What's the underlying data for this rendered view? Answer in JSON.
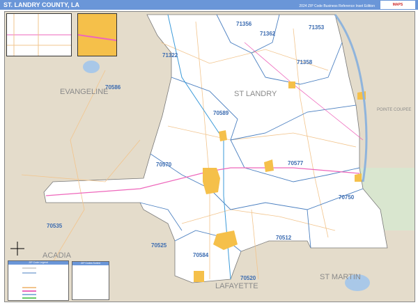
{
  "header": {
    "title": "ST. LANDRY COUNTY, LA",
    "edition": "2024 ZIP Code Business Reference Inset Edition",
    "logo": "MAPS"
  },
  "map": {
    "zip_labels": [
      {
        "code": "71322"
      },
      {
        "code": "71356"
      },
      {
        "code": "71362"
      },
      {
        "code": "71353"
      },
      {
        "code": "71358"
      },
      {
        "code": "70586"
      },
      {
        "code": "70589"
      },
      {
        "code": "70570"
      },
      {
        "code": "70577"
      },
      {
        "code": "70750"
      },
      {
        "code": "70535"
      },
      {
        "code": "70525"
      },
      {
        "code": "70512"
      },
      {
        "code": "70584"
      },
      {
        "code": "70520"
      }
    ],
    "county_labels": [
      "EVANGELINE",
      "ST LANDRY",
      "POINTE COUPEE",
      "ACADIA",
      "LAFAYETTE",
      "ST MARTIN"
    ],
    "colors": {
      "county": "#ffffff",
      "surrounding": "#e4dccb",
      "city": "#f5c04a",
      "zip_boundary": "#4a7fc0",
      "interstate": "#ee66bb",
      "water": "#a9c8e8",
      "roads": "#f2c48c"
    }
  },
  "legend": {
    "title": "ZIP Code Legend"
  },
  "zip_table": {
    "title": "ZIP Codes Sorted"
  }
}
